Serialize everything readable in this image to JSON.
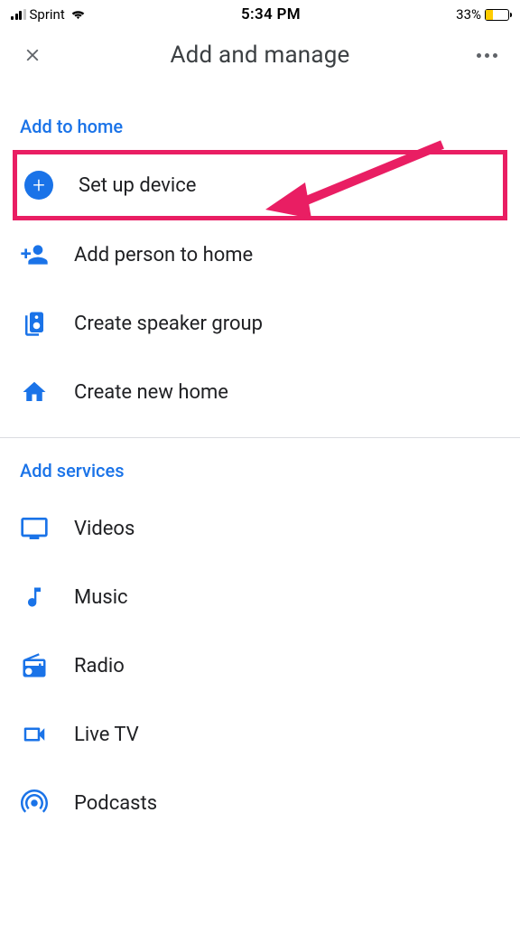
{
  "status_bar": {
    "carrier": "Sprint",
    "time": "5:34 PM",
    "battery_pct": "33%"
  },
  "header": {
    "title": "Add and manage"
  },
  "sections": {
    "add_to_home": {
      "title": "Add to home",
      "items": [
        {
          "label": "Set up device"
        },
        {
          "label": "Add person to home"
        },
        {
          "label": "Create speaker group"
        },
        {
          "label": "Create new home"
        }
      ]
    },
    "add_services": {
      "title": "Add services",
      "items": [
        {
          "label": "Videos"
        },
        {
          "label": "Music"
        },
        {
          "label": "Radio"
        },
        {
          "label": "Live TV"
        },
        {
          "label": "Podcasts"
        }
      ]
    }
  },
  "colors": {
    "accent": "#1a73e8",
    "highlight": "#e91e63"
  }
}
